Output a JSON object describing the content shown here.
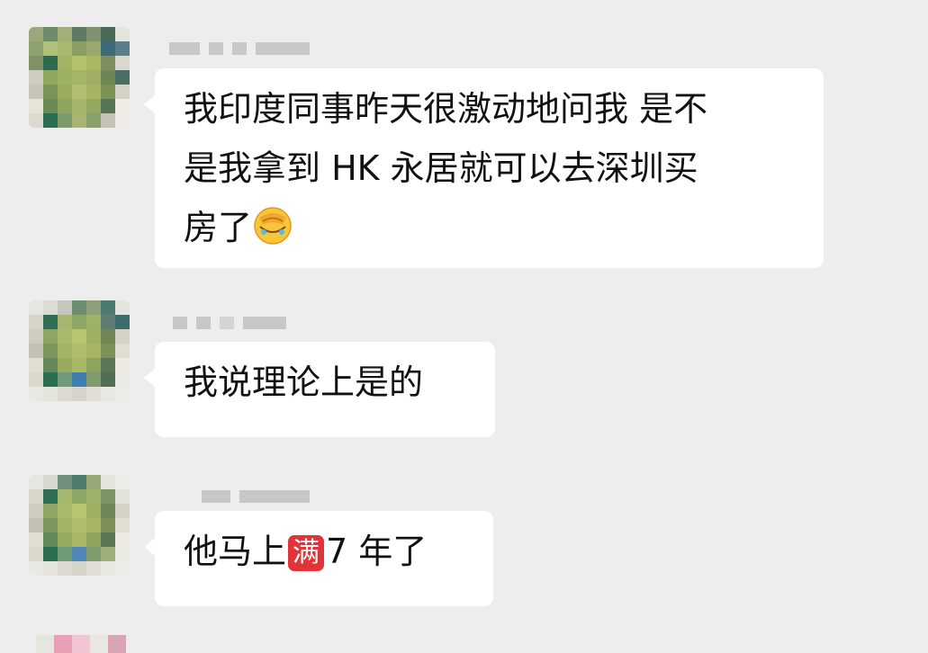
{
  "messages": [
    {
      "text_line1": "我印度同事昨天很激动地问我 是不",
      "text_line2": "是我拿到 HK 永居就可以去深圳买",
      "text_line3": "房了",
      "emoji": "face-with-hand-over-face-icon"
    },
    {
      "text_line1": "我说理论上是的"
    },
    {
      "text_before": "他马上",
      "badge": "满",
      "text_after": "7 年了"
    }
  ],
  "colors": {
    "background": "#ededed",
    "bubble": "#ffffff",
    "badge": "#e0343a",
    "redacted": "#c8c8c8"
  }
}
